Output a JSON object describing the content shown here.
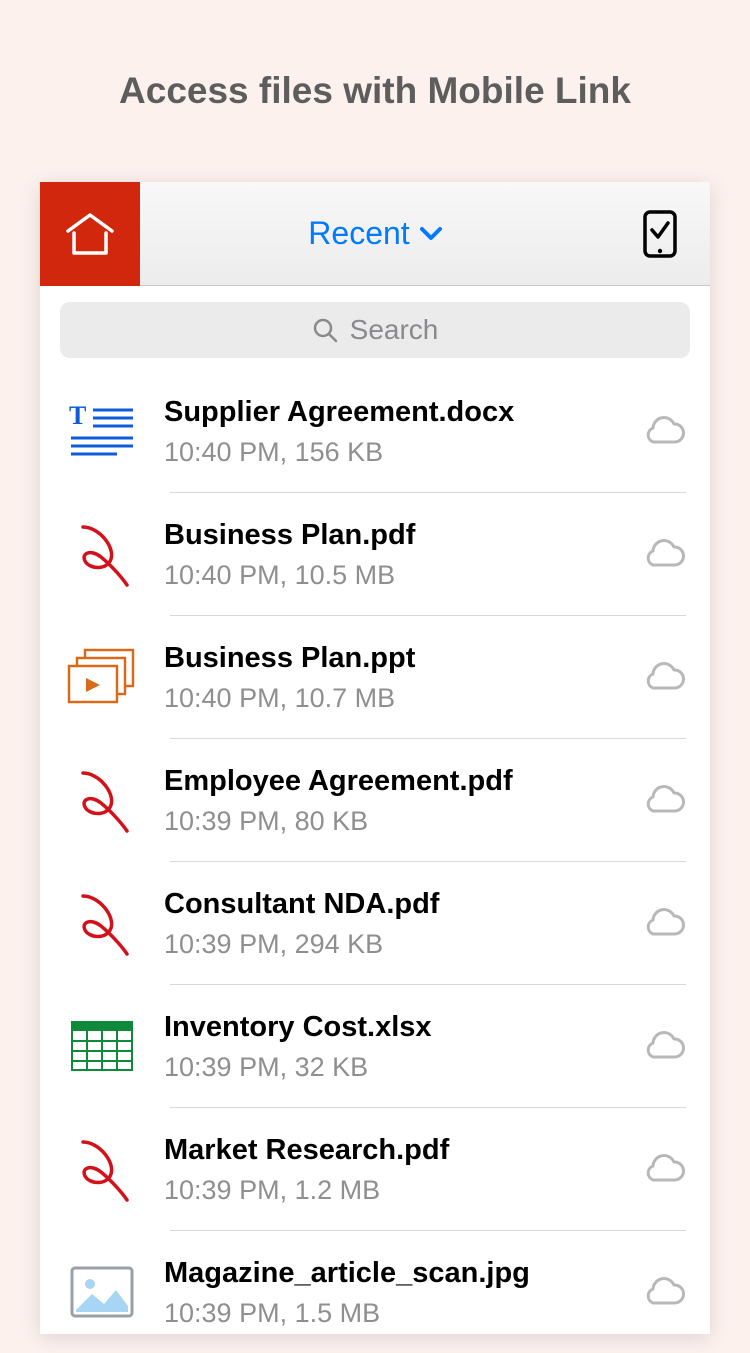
{
  "page_title": "Access files with Mobile Link",
  "navbar": {
    "title_label": "Recent"
  },
  "search": {
    "placeholder": "Search"
  },
  "files": [
    {
      "name": "Supplier Agreement.docx",
      "meta": "10:40 PM, 156 KB",
      "icon": "docx"
    },
    {
      "name": "Business Plan.pdf",
      "meta": "10:40 PM, 10.5 MB",
      "icon": "pdf"
    },
    {
      "name": "Business Plan.ppt",
      "meta": "10:40 PM, 10.7 MB",
      "icon": "ppt"
    },
    {
      "name": "Employee Agreement.pdf",
      "meta": "10:39 PM, 80 KB",
      "icon": "pdf"
    },
    {
      "name": "Consultant NDA.pdf",
      "meta": "10:39 PM, 294 KB",
      "icon": "pdf"
    },
    {
      "name": "Inventory Cost.xlsx",
      "meta": "10:39 PM, 32 KB",
      "icon": "xlsx"
    },
    {
      "name": "Market Research.pdf",
      "meta": "10:39 PM, 1.2 MB",
      "icon": "pdf"
    },
    {
      "name": "Magazine_article_scan.jpg",
      "meta": "10:39 PM, 1.5 MB",
      "icon": "jpg"
    }
  ]
}
